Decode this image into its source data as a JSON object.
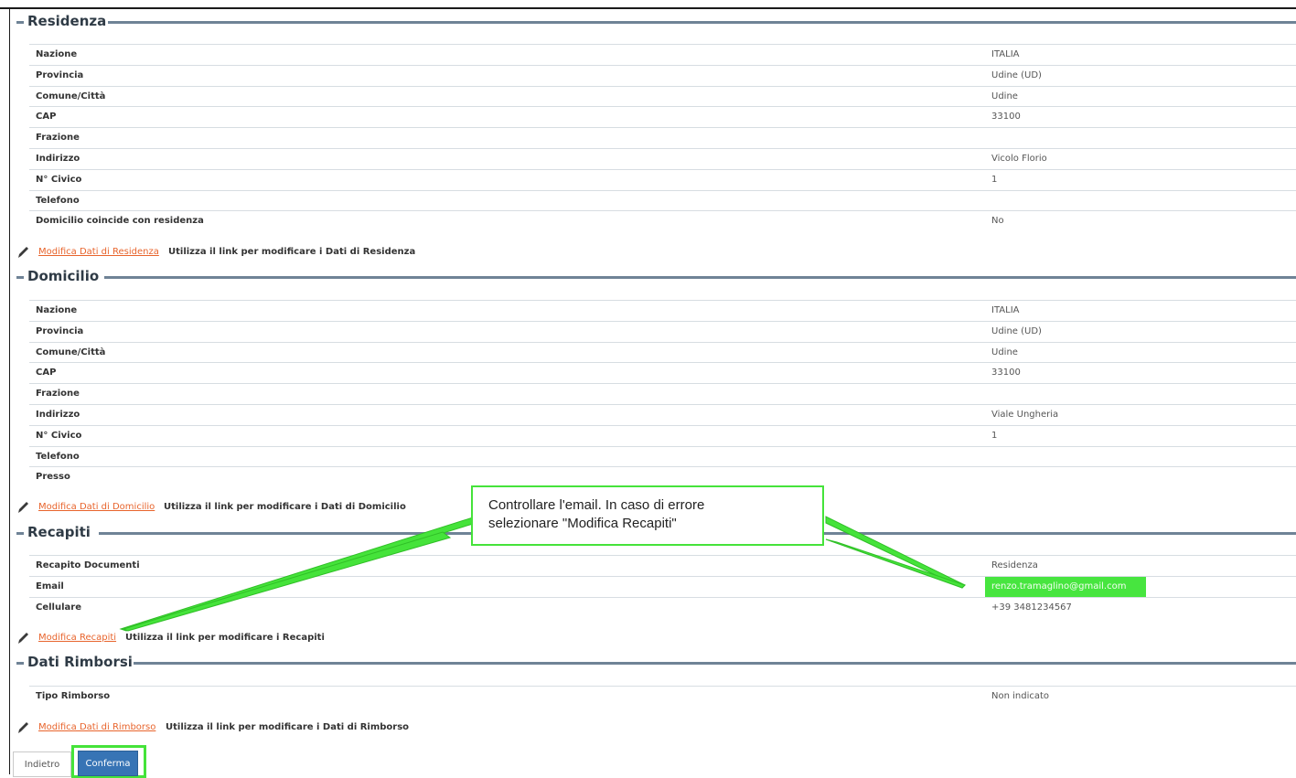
{
  "sections": {
    "residenza": {
      "title": "Residenza",
      "rows": [
        {
          "label": "Nazione",
          "value": "ITALIA"
        },
        {
          "label": "Provincia",
          "value": "Udine (UD)"
        },
        {
          "label": "Comune/Città",
          "value": "Udine"
        },
        {
          "label": "CAP",
          "value": "33100"
        },
        {
          "label": "Frazione",
          "value": ""
        },
        {
          "label": "Indirizzo",
          "value": "Vicolo Florio"
        },
        {
          "label": "N° Civico",
          "value": "1"
        },
        {
          "label": "Telefono",
          "value": ""
        },
        {
          "label": "Domicilio coincide con residenza",
          "value": "No"
        }
      ],
      "edit_link": "Modifica Dati di Residenza",
      "edit_hint": "Utilizza il link per modificare i Dati di Residenza"
    },
    "domicilio": {
      "title": "Domicilio",
      "rows": [
        {
          "label": "Nazione",
          "value": "ITALIA"
        },
        {
          "label": "Provincia",
          "value": "Udine (UD)"
        },
        {
          "label": "Comune/Città",
          "value": "Udine"
        },
        {
          "label": "CAP",
          "value": "33100"
        },
        {
          "label": "Frazione",
          "value": ""
        },
        {
          "label": "Indirizzo",
          "value": "Viale Ungheria"
        },
        {
          "label": "N° Civico",
          "value": "1"
        },
        {
          "label": "Telefono",
          "value": ""
        },
        {
          "label": "Presso",
          "value": ""
        }
      ],
      "edit_link": "Modifica Dati di Domicilio",
      "edit_hint": "Utilizza il link per modificare i Dati di Domicilio"
    },
    "recapiti": {
      "title": "Recapiti",
      "rows": [
        {
          "label": "Recapito Documenti",
          "value": "Residenza"
        },
        {
          "label": "Email",
          "value": "renzo.tramaglino@gmail.com"
        },
        {
          "label": "Cellulare",
          "value": "+39 3481234567"
        }
      ],
      "edit_link": "Modifica Recapiti",
      "edit_hint": "Utilizza il link per modificare i Recapiti"
    },
    "rimborsi": {
      "title": "Dati Rimborsi",
      "rows": [
        {
          "label": "Tipo Rimborso",
          "value": "Non indicato"
        }
      ],
      "edit_link": "Modifica Dati di Rimborso",
      "edit_hint": "Utilizza il link per modificare i Dati di Rimborso"
    }
  },
  "callout": {
    "text": "Controllare l'email. In caso di errore\nselezionare \"Modifica Recapiti\""
  },
  "buttons": {
    "back_label": "Indietro",
    "confirm_label": "Conferma"
  },
  "colors": {
    "link": "#e8642c",
    "highlight": "#45e33a",
    "primary_button": "#3774b5",
    "section_rule": "#6f8396"
  },
  "icons": {
    "edit": "pencil-icon"
  }
}
